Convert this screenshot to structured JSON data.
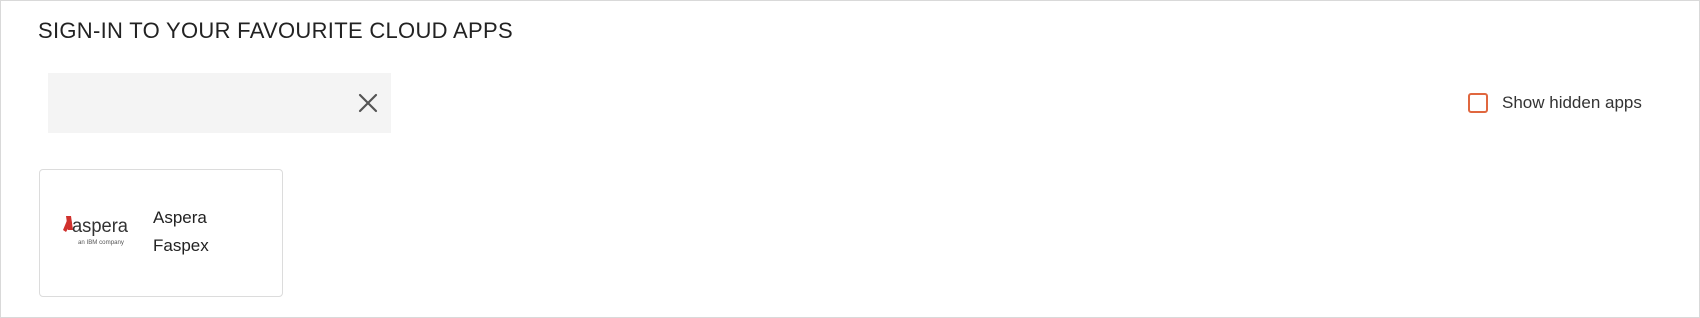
{
  "header": {
    "title": "SIGN-IN TO YOUR FAVOURITE CLOUD APPS"
  },
  "search": {
    "value": "",
    "placeholder": "",
    "clear_icon": "close-icon"
  },
  "filters": {
    "show_hidden_label": "Show hidden apps",
    "show_hidden_checked": false
  },
  "apps": [
    {
      "name": "Aspera Faspex",
      "logo": {
        "wordmark": "aspera",
        "tagline": "an IBM company",
        "brand_color": "#d0312d"
      }
    }
  ],
  "colors": {
    "accent": "#e0673f",
    "search_bg": "#f4f4f4"
  }
}
